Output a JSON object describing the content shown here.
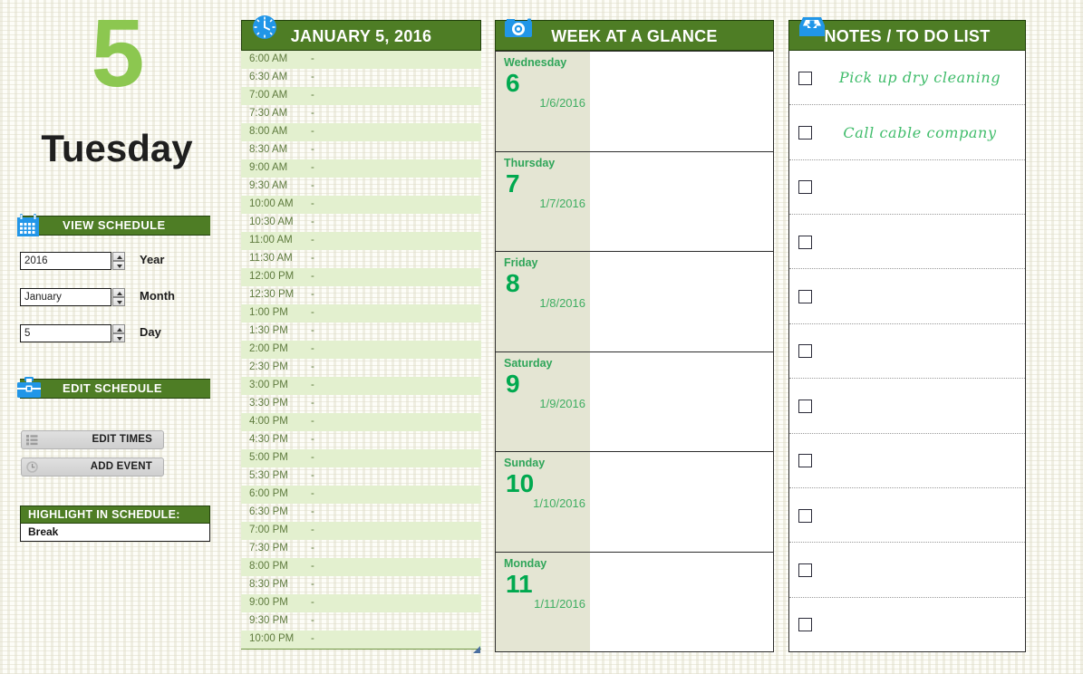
{
  "sidebar": {
    "day_number": "5",
    "day_name": "Tuesday",
    "view_schedule": {
      "label": "VIEW SCHEDULE",
      "icon": "calendar-icon"
    },
    "fields": [
      {
        "value": "2016",
        "label": "Year",
        "name": "year"
      },
      {
        "value": "January",
        "label": "Month",
        "name": "month"
      },
      {
        "value": "5",
        "label": "Day",
        "name": "day"
      }
    ],
    "edit_schedule": {
      "label": "EDIT SCHEDULE",
      "icon": "toolbox-icon"
    },
    "buttons": [
      {
        "label": "EDIT TIMES",
        "icon": "list-icon"
      },
      {
        "label": "ADD EVENT",
        "icon": "clock-icon"
      }
    ],
    "highlight": {
      "title": "HIGHLIGHT IN SCHEDULE:",
      "value": "Break"
    }
  },
  "schedule": {
    "title": "JANUARY 5, 2016",
    "icon": "clock-icon",
    "slots": [
      {
        "time": "6:00 AM",
        "event": "-"
      },
      {
        "time": "6:30 AM",
        "event": "-"
      },
      {
        "time": "7:00 AM",
        "event": "-"
      },
      {
        "time": "7:30 AM",
        "event": "-"
      },
      {
        "time": "8:00 AM",
        "event": "-"
      },
      {
        "time": "8:30 AM",
        "event": "-"
      },
      {
        "time": "9:00 AM",
        "event": "-"
      },
      {
        "time": "9:30 AM",
        "event": "-"
      },
      {
        "time": "10:00 AM",
        "event": "-"
      },
      {
        "time": "10:30 AM",
        "event": "-"
      },
      {
        "time": "11:00 AM",
        "event": "-"
      },
      {
        "time": "11:30 AM",
        "event": "-"
      },
      {
        "time": "12:00 PM",
        "event": "-"
      },
      {
        "time": "12:30 PM",
        "event": "-"
      },
      {
        "time": "1:00 PM",
        "event": "-"
      },
      {
        "time": "1:30 PM",
        "event": "-"
      },
      {
        "time": "2:00 PM",
        "event": "-"
      },
      {
        "time": "2:30 PM",
        "event": "-"
      },
      {
        "time": "3:00 PM",
        "event": "-"
      },
      {
        "time": "3:30 PM",
        "event": "-"
      },
      {
        "time": "4:00 PM",
        "event": "-"
      },
      {
        "time": "4:30 PM",
        "event": "-"
      },
      {
        "time": "5:00 PM",
        "event": "-"
      },
      {
        "time": "5:30 PM",
        "event": "-"
      },
      {
        "time": "6:00 PM",
        "event": "-"
      },
      {
        "time": "6:30 PM",
        "event": "-"
      },
      {
        "time": "7:00 PM",
        "event": "-"
      },
      {
        "time": "7:30 PM",
        "event": "-"
      },
      {
        "time": "8:00 PM",
        "event": "-"
      },
      {
        "time": "8:30 PM",
        "event": "-"
      },
      {
        "time": "9:00 PM",
        "event": "-"
      },
      {
        "time": "9:30 PM",
        "event": "-"
      },
      {
        "time": "10:00 PM",
        "event": "-"
      }
    ]
  },
  "week": {
    "title": "WEEK AT A GLANCE",
    "icon": "camera-icon",
    "days": [
      {
        "dayname": "Wednesday",
        "daynum": "6",
        "date": "1/6/2016",
        "event": ""
      },
      {
        "dayname": "Thursday",
        "daynum": "7",
        "date": "1/7/2016",
        "event": ""
      },
      {
        "dayname": "Friday",
        "daynum": "8",
        "date": "1/8/2016",
        "event": ""
      },
      {
        "dayname": "Saturday",
        "daynum": "9",
        "date": "1/9/2016",
        "event": ""
      },
      {
        "dayname": "Sunday",
        "daynum": "10",
        "date": "1/10/2016",
        "event": ""
      },
      {
        "dayname": "Monday",
        "daynum": "11",
        "date": "1/11/2016",
        "event": ""
      }
    ]
  },
  "notes": {
    "title": "NOTES / TO DO LIST",
    "icon": "inbox-icon",
    "items": [
      {
        "text": "Pick up dry cleaning",
        "checked": false
      },
      {
        "text": "Call cable company",
        "checked": false
      },
      {
        "text": "",
        "checked": false
      },
      {
        "text": "",
        "checked": false
      },
      {
        "text": "",
        "checked": false
      },
      {
        "text": "",
        "checked": false
      },
      {
        "text": "",
        "checked": false
      },
      {
        "text": "",
        "checked": false
      },
      {
        "text": "",
        "checked": false
      },
      {
        "text": "",
        "checked": false
      },
      {
        "text": "",
        "checked": false
      }
    ]
  },
  "colors": {
    "header_green": "#4e7d25",
    "accent_light_green": "#8cc750",
    "row_tint": "#e3f0cf",
    "week_left": "#e4e5d3",
    "day_number_green": "#00a94f",
    "icon_blue": "#2196e8"
  }
}
